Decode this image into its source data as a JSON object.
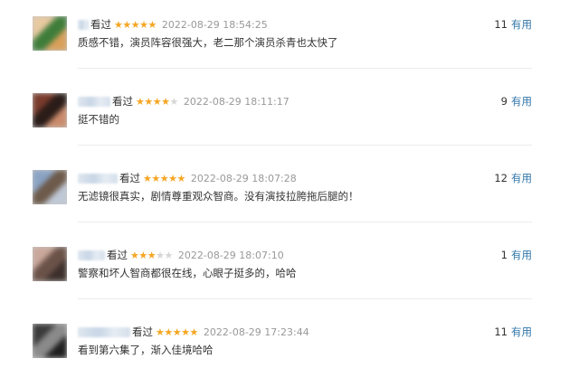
{
  "reviews": [
    {
      "watched_label": "看过",
      "rating": 5,
      "time": "2022-08-29 18:54:25",
      "content": "质感不错，演员阵容很强大，老二那个演员杀青也太快了",
      "votes": "11",
      "useful_label": "有用"
    },
    {
      "watched_label": "看过",
      "rating": 4,
      "time": "2022-08-29 18:11:17",
      "content": "挺不错的",
      "votes": "9",
      "useful_label": "有用"
    },
    {
      "watched_label": "看过",
      "rating": 5,
      "time": "2022-08-29 18:07:28",
      "content": "无滤镜很真实，剧情尊重观众智商。没有演技拉胯拖后腿的！",
      "votes": "12",
      "useful_label": "有用"
    },
    {
      "watched_label": "看过",
      "rating": 3,
      "time": "2022-08-29 18:07:10",
      "content": "警察和坏人智商都很在线，心眼子挺多的，哈哈",
      "votes": "1",
      "useful_label": "有用"
    },
    {
      "watched_label": "看过",
      "rating": 5,
      "time": "2022-08-29 17:23:44",
      "content": "看到第六集了，渐入佳境哈哈",
      "votes": "11",
      "useful_label": "有用"
    }
  ],
  "avatar_colors": [
    [
      "#e8c9a0",
      "#3f7d3a",
      "#d9a05a"
    ],
    [
      "#7a3b2c",
      "#2a1c18",
      "#c98a6b"
    ],
    [
      "#8aa3c4",
      "#6d5a4a",
      "#bfc8d6"
    ],
    [
      "#c9a79a",
      "#6b5248",
      "#3c2f2b"
    ],
    [
      "#3a3a3a",
      "#8a8a8a",
      "#1f1f1f"
    ]
  ],
  "colors": {
    "star_on": "#f5a623",
    "star_off": "#d6d6d6",
    "link": "#3377aa",
    "time": "#999999"
  }
}
